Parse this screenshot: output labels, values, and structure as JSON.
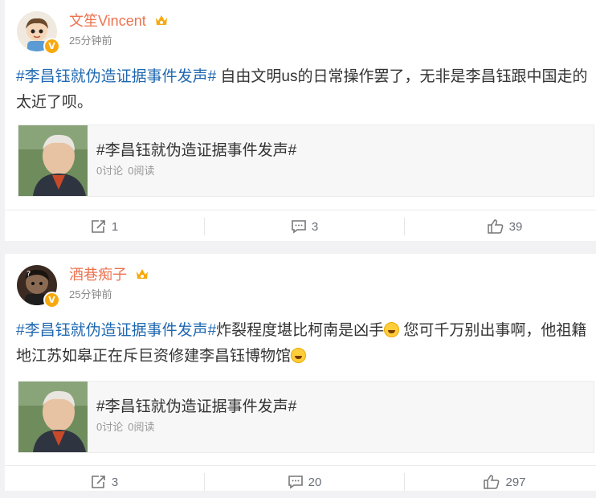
{
  "posts": [
    {
      "username": "文笙Vincent",
      "time": "25分钟前",
      "topic": "#李昌钰就伪造证据事件发声#",
      "text": " 自由文明us的日常操作罢了，无非是李昌钰跟中国走的太近了呗。",
      "card": {
        "title": "#李昌钰就伪造证据事件发声#",
        "discuss": "0讨论",
        "reads": "0阅读"
      },
      "actions": {
        "repost": "1",
        "comment": "3",
        "like": "39"
      }
    },
    {
      "username": "酒巷痴子",
      "time": "25分钟前",
      "topic": "#李昌钰就伪造证据事件发声#",
      "text_part1": "炸裂程度堪比柯南是凶手",
      "text_part2": " 您可千万别出事啊，他祖籍地江苏如皋正在斥巨资修建李昌钰博物馆",
      "card": {
        "title": "#李昌钰就伪造证据事件发声#",
        "discuss": "0讨论",
        "reads": "0阅读"
      },
      "actions": {
        "repost": "3",
        "comment": "20",
        "like": "297"
      }
    }
  ],
  "badges": {
    "verified": "V"
  },
  "colors": {
    "username": "#eb7350",
    "topic": "#1f68b1",
    "meta": "#888888",
    "action": "#696e78"
  }
}
